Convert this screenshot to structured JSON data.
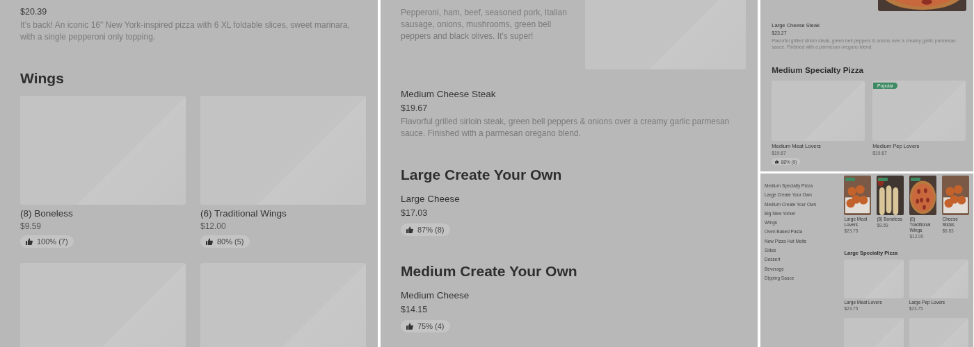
{
  "panels": [
    {
      "kind": "large",
      "blocks": [
        {
          "kind": "item",
          "price": "$20.39",
          "description": "It's back! An iconic 16\" New York-inspired pizza with 6 XL foldable slices, sweet marinara, with a single pepperoni only topping."
        },
        {
          "kind": "heading",
          "text": "Wings"
        },
        {
          "kind": "grid",
          "items": [
            {
              "kind": "placeholder",
              "name": "(8) Boneless",
              "price": "$9.59",
              "rating": "100% (7)"
            },
            {
              "kind": "placeholder",
              "name": "(6) Traditional Wings",
              "price": "$12.00",
              "rating": "80% (5)"
            },
            {
              "kind": "placeholder"
            },
            {
              "kind": "placeholder"
            }
          ]
        }
      ]
    },
    {
      "kind": "large",
      "blocks": [
        {
          "kind": "item",
          "description": "Pepperoni, ham, beef, seasoned pork, Italian sausage, onions, mushrooms, green bell peppers and black olives. It's super!",
          "media": {
            "kind": "placeholder"
          }
        },
        {
          "kind": "item",
          "name": "Medium Cheese Steak",
          "price": "$19.67",
          "description": "Flavorful grilled sirloin steak, green bell peppers & onions over a creamy garlic parmesan sauce. Finished with a parmesan oregano blend."
        },
        {
          "kind": "heading",
          "text": "Large Create Your Own"
        },
        {
          "kind": "item",
          "name": "Large Cheese",
          "price": "$17.03",
          "rating": "87% (8)"
        },
        {
          "kind": "heading",
          "text": "Medium Create Your Own"
        },
        {
          "kind": "item",
          "name": "Medium Cheese",
          "price": "$14.15",
          "rating": "75% (4)"
        }
      ]
    },
    {
      "kind": "medium",
      "blocks": [
        {
          "kind": "item"
        },
        {
          "kind": "item",
          "name": "Large Cheese Steak",
          "price": "$23.27",
          "description": "Flavorful grilled sirloin steak, green bell peppers & onions over a creamy garlic parmesan sauce. Finished with a parmesan oregano blend."
        },
        {
          "kind": "heading",
          "text": "Medium Specialty Pizza"
        },
        {
          "kind": "grid",
          "items": [
            {
              "kind": "placeholder",
              "name": "Medium Meat Lovers",
              "price": "$19.67",
              "rating": "88% (9)"
            },
            {
              "kind": "placeholder",
              "badge": "Popular",
              "name": "Medium Pep Lovers",
              "price": "$19.67"
            }
          ]
        }
      ]
    },
    {
      "kind": "small",
      "sidebar": [
        "Medium Specialty Pizza",
        "Large Create Your Own",
        "Medium Create Your Own",
        "Big New Yorker",
        "Wings",
        "Oven Baked Pasta",
        "New Pizza Hut Melts",
        "Sides",
        "Dessert",
        "Beverage",
        "Dipping Sauce"
      ],
      "blocks": [
        {
          "kind": "carousel",
          "items": [
            {
              "kind": "picture",
              "promo": true,
              "name": "Large Meat Lovers",
              "price": "$23.75"
            },
            {
              "kind": "picture",
              "promo": true,
              "name": "(8) Boneless",
              "price": "$9.59"
            },
            {
              "kind": "picture",
              "promo": true,
              "name": "(6) Traditional Wings",
              "price": "$12.00"
            },
            {
              "kind": "picture",
              "promo": false,
              "name": "Cheese Sticks",
              "price": "$6.83"
            }
          ]
        },
        {
          "kind": "heading",
          "text": "Large Specialty Pizza"
        },
        {
          "kind": "grid",
          "items": [
            {
              "kind": "placeholder",
              "name": "Large Meat Lovers",
              "price": "$23.75"
            },
            {
              "kind": "placeholder",
              "name": "Large Pep Lovers",
              "price": "$23.75"
            },
            {
              "kind": "placeholder"
            },
            {
              "kind": "placeholder"
            }
          ]
        }
      ]
    }
  ]
}
